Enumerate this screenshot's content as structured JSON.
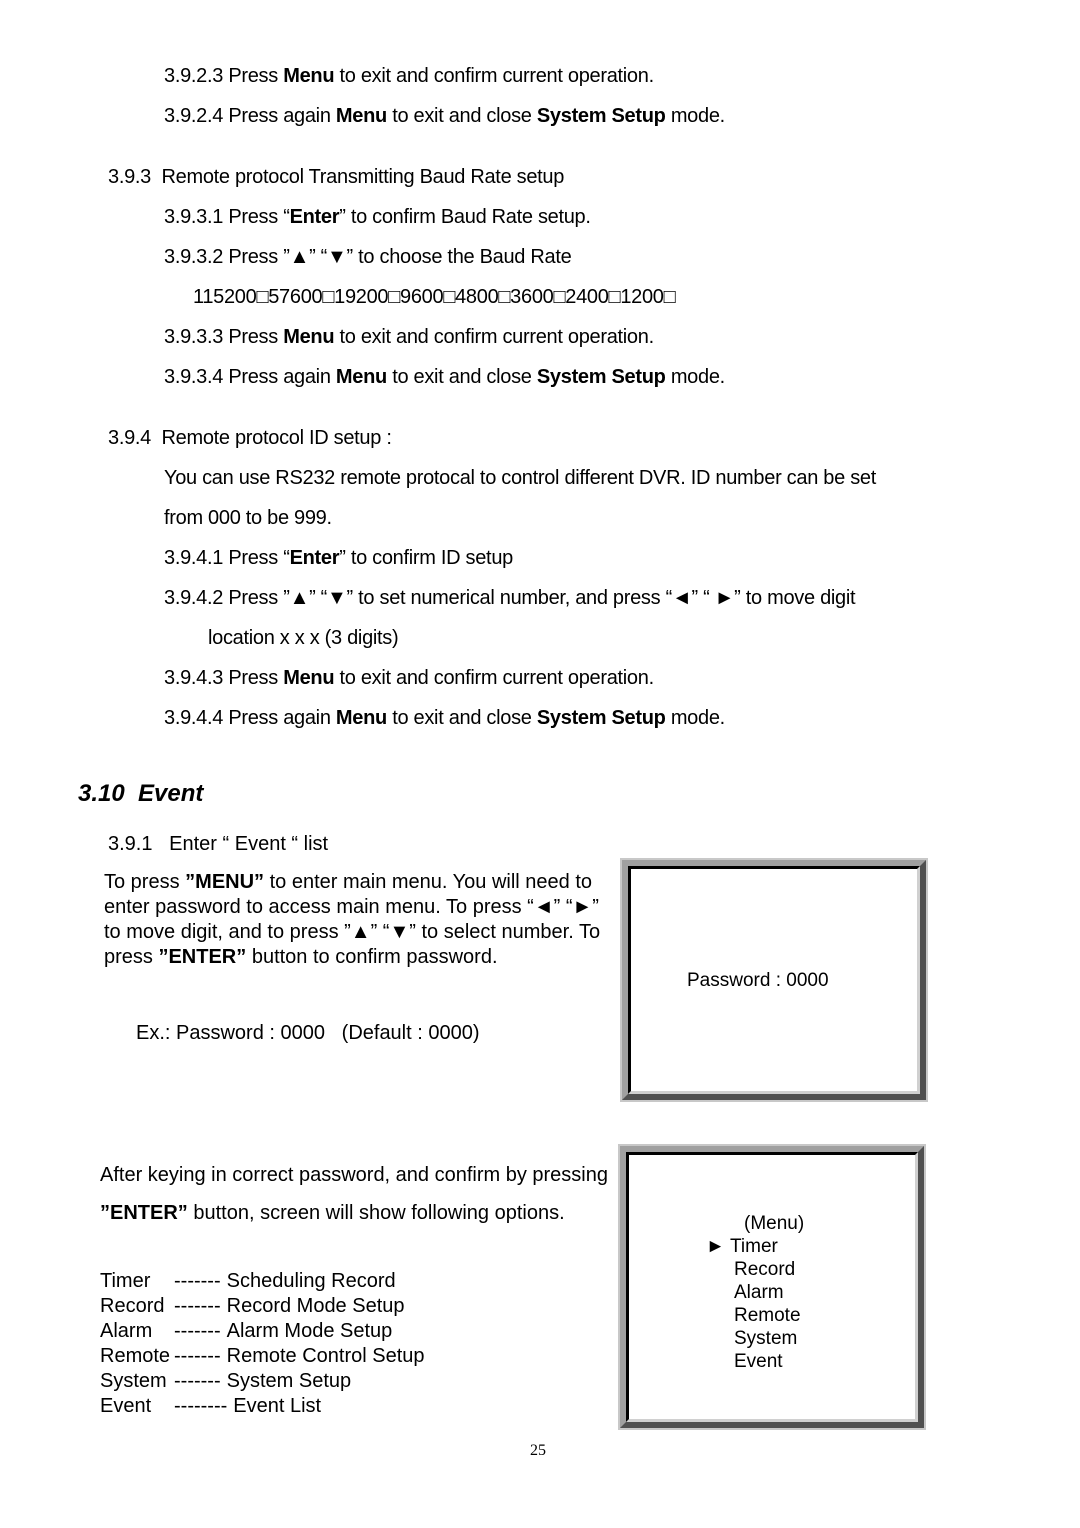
{
  "section_3_9_2": {
    "step3": {
      "num": "3.9.2.3",
      "pre": "Press ",
      "bold": "Menu",
      "post": " to exit and confirm current operation."
    },
    "step4": {
      "num": "3.9.2.4",
      "pre": "Press again ",
      "bold1": "Menu",
      "mid": " to exit and close ",
      "bold2": "System Setup",
      "post": " mode."
    }
  },
  "section_3_9_3": {
    "title_num": "3.9.3",
    "title": "Remote protocol Transmitting Baud Rate setup",
    "step1": {
      "num": "3.9.3.1",
      "pre": "Press “",
      "bold": "Enter",
      "post": "” to confirm Baud Rate setup."
    },
    "step2": {
      "num": "3.9.3.2",
      "text": "Press ”▲” “▼” to choose the Baud Rate"
    },
    "baud_rates": "115200□57600□19200□9600□4800□3600□2400□1200□",
    "step3": {
      "num": "3.9.3.3",
      "pre": "Press ",
      "bold": "Menu",
      "post": " to exit and confirm current operation."
    },
    "step4": {
      "num": "3.9.3.4",
      "pre": "Press again ",
      "bold1": "Menu",
      "mid": " to exit and close ",
      "bold2": "System Setup",
      "post": " mode."
    }
  },
  "section_3_9_4": {
    "title_num": "3.9.4",
    "title": "Remote protocol ID setup :",
    "desc_line1": "You can use RS232 remote protocal to control different DVR. ID number can be set",
    "desc_line2": "from 000 to be 999.",
    "step1": {
      "num": "3.9.4.1",
      "pre": "Press “",
      "bold": "Enter",
      "post": "” to confirm ID setup"
    },
    "step2": {
      "num": "3.9.4.2",
      "text": "Press ”▲” “▼” to set numerical number, and press “◄” “ ►” to move digit",
      "cont": "location x x x (3 digits)"
    },
    "step3": {
      "num": "3.9.4.3",
      "pre": "Press ",
      "bold": "Menu",
      "post": " to exit and confirm current operation."
    },
    "step4": {
      "num": "3.9.4.4",
      "pre": "Press again ",
      "bold1": "Menu",
      "mid": " to exit and close ",
      "bold2": "System Setup",
      "post": " mode."
    }
  },
  "section_3_10": {
    "heading": "3.10  Event",
    "sub_num": "3.9.1",
    "sub_title": "Enter “ Event “ list",
    "intro": {
      "p1": "To press ",
      "b1": "”MENU”",
      "p2": " to enter main menu. You will need to enter password to access main menu. To press “◄” “►”   to move digit, and to press   ”▲” “▼” to select number. To press ",
      "b2": "”ENTER”",
      "p3": " button to confirm password."
    },
    "example": "Ex.: Password : 0000   (Default : 0000)",
    "password_screen": {
      "text": "Password : 0000"
    },
    "after": {
      "p1": "After keying in correct password, and confirm by pressing ",
      "b1": "”ENTER”",
      "p2": " button, screen will show following options."
    },
    "options": [
      {
        "name": "Timer",
        "dashes": "-------",
        "desc": "Scheduling Record"
      },
      {
        "name": "Record",
        "dashes": "-------",
        "desc": "Record Mode Setup"
      },
      {
        "name": "Alarm",
        "dashes": "-------",
        "desc": "Alarm Mode Setup"
      },
      {
        "name": "Remote",
        "dashes": "-------",
        "desc": "Remote Control Setup"
      },
      {
        "name": "System",
        "dashes": "-------",
        "desc": "System Setup"
      },
      {
        "name": "Event",
        "dashes": "--------",
        "desc": "Event List"
      }
    ],
    "menu_screen": {
      "title": "(Menu)",
      "cursor": "►",
      "items": [
        "Timer",
        "Record",
        "Alarm",
        "Remote",
        "System",
        "Event"
      ],
      "selected_index": 0
    }
  },
  "page_number": "25"
}
